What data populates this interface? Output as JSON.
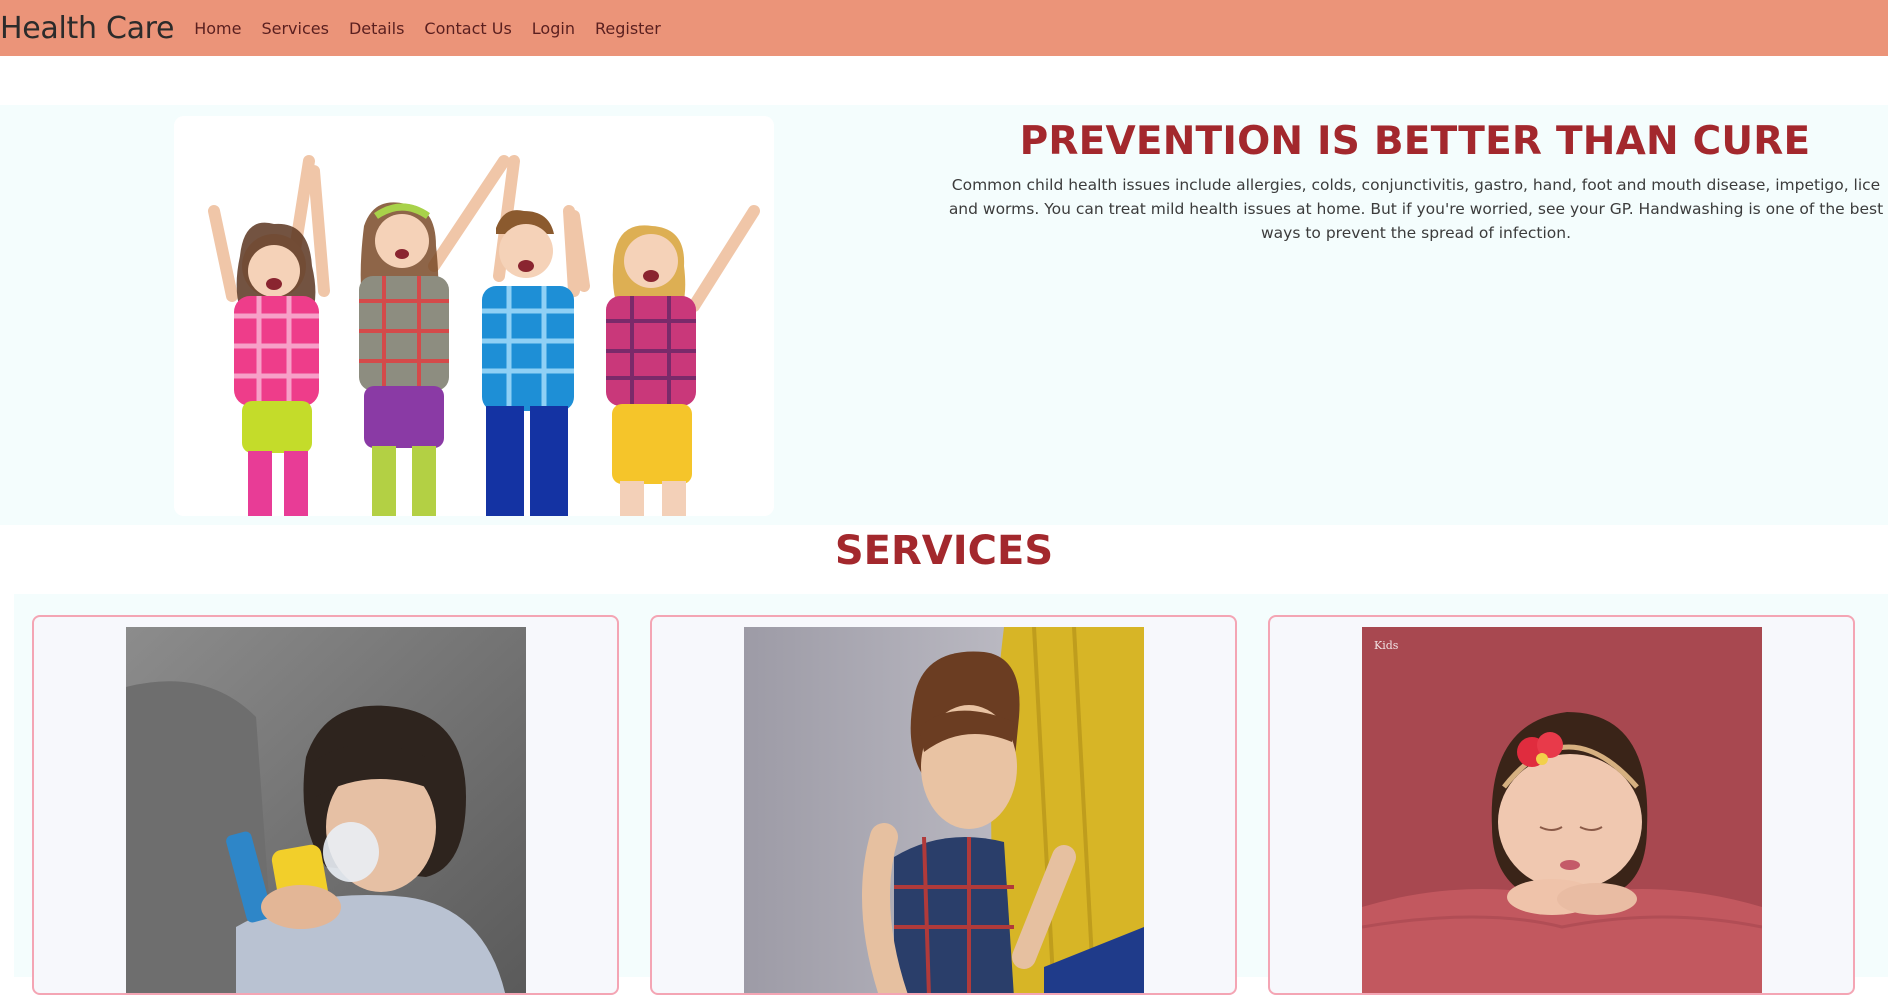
{
  "navbar": {
    "brand": "Health Care",
    "links": [
      "Home",
      "Services",
      "Details",
      "Contact Us",
      "Login",
      "Register"
    ]
  },
  "hero": {
    "title": "PREVENTION IS BETTER THAN CURE",
    "text": "Common child health issues include allergies, colds, conjunctivitis, gastro, hand, foot and mouth disease, impetigo, lice and worms. You can treat mild health issues at home. But if you're worried, see your GP. Handwashing is one of the best ways to prevent the spread of infection."
  },
  "services": {
    "title": "SERVICES",
    "cards": [
      {
        "image": "child-with-inhaler-photo"
      },
      {
        "image": "child-hugging-parent-photo"
      },
      {
        "image": "sleeping-newborn-photo",
        "watermark": "Kids"
      }
    ]
  },
  "colors": {
    "navbar": "#eb9479",
    "accent": "#a3282d",
    "hero_bg": "#f4fdfd",
    "card_border": "#f4a5b4"
  }
}
